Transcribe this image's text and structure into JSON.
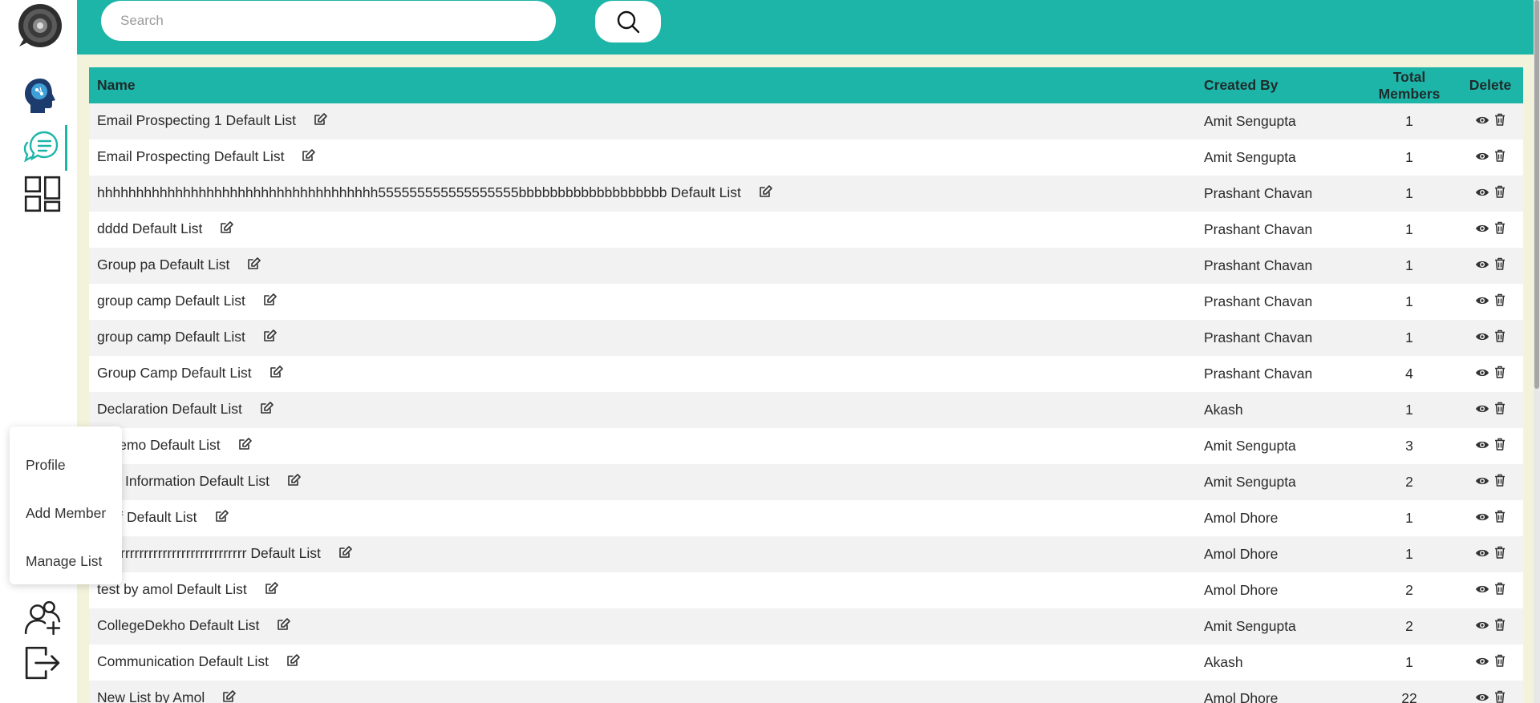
{
  "search": {
    "placeholder": "Search"
  },
  "sidebar": {
    "icons": [
      "logo-icon",
      "brain-icon",
      "chat-icon",
      "dashboard-icon",
      "add-user-icon",
      "logout-icon"
    ]
  },
  "popup_menu": {
    "items": [
      "Profile",
      "Add Member",
      "Manage List"
    ]
  },
  "table": {
    "headers": {
      "name": "Name",
      "created_by": "Created By",
      "total": "Total Members",
      "delete": "Delete"
    },
    "rows": [
      {
        "name": "Email Prospecting 1 Default List",
        "created_by": "Amit Sengupta",
        "total": "1"
      },
      {
        "name": "Email Prospecting Default List",
        "created_by": "Amit Sengupta",
        "total": "1"
      },
      {
        "name": "hhhhhhhhhhhhhhhhhhhhhhhhhhhhhhhhhhhh555555555555555555bbbbbbbbbbbbbbbbbbb Default List",
        "created_by": "Prashant Chavan",
        "total": "1"
      },
      {
        "name": "dddd Default List",
        "created_by": "Prashant Chavan",
        "total": "1"
      },
      {
        "name": "Group pa Default List",
        "created_by": "Prashant Chavan",
        "total": "1"
      },
      {
        "name": "group camp Default List",
        "created_by": "Prashant Chavan",
        "total": "1"
      },
      {
        "name": "group camp Default List",
        "created_by": "Prashant Chavan",
        "total": "1"
      },
      {
        "name": "Group Camp Default List",
        "created_by": "Prashant Chavan",
        "total": "4"
      },
      {
        "name": "Declaration Default List",
        "created_by": "Akash",
        "total": "1"
      },
      {
        "name": "lr Demo Default List",
        "created_by": "Amit Sengupta",
        "total": "3"
      },
      {
        "name": "ture Information Default List",
        "created_by": "Amit Sengupta",
        "total": "2"
      },
      {
        "name": "fffffff Default List",
        "created_by": "Amol Dhore",
        "total": "1"
      },
      {
        "name": "rrrrrrrrrrrrrrrrrrrrrrrrrrrrrrrr Default List",
        "created_by": "Amol Dhore",
        "total": "1"
      },
      {
        "name": "test by amol Default List",
        "created_by": "Amol Dhore",
        "total": "2"
      },
      {
        "name": "CollegeDekho Default List",
        "created_by": "Amit Sengupta",
        "total": "2"
      },
      {
        "name": "Communication Default List",
        "created_by": "Akash",
        "total": "1"
      },
      {
        "name": "New List by Amol",
        "created_by": "Amol Dhore",
        "total": "22"
      }
    ]
  },
  "colors": {
    "accent": "#1eb5a9",
    "page_bg": "#f3f3dc",
    "row_alt": "#f2f2f2"
  }
}
